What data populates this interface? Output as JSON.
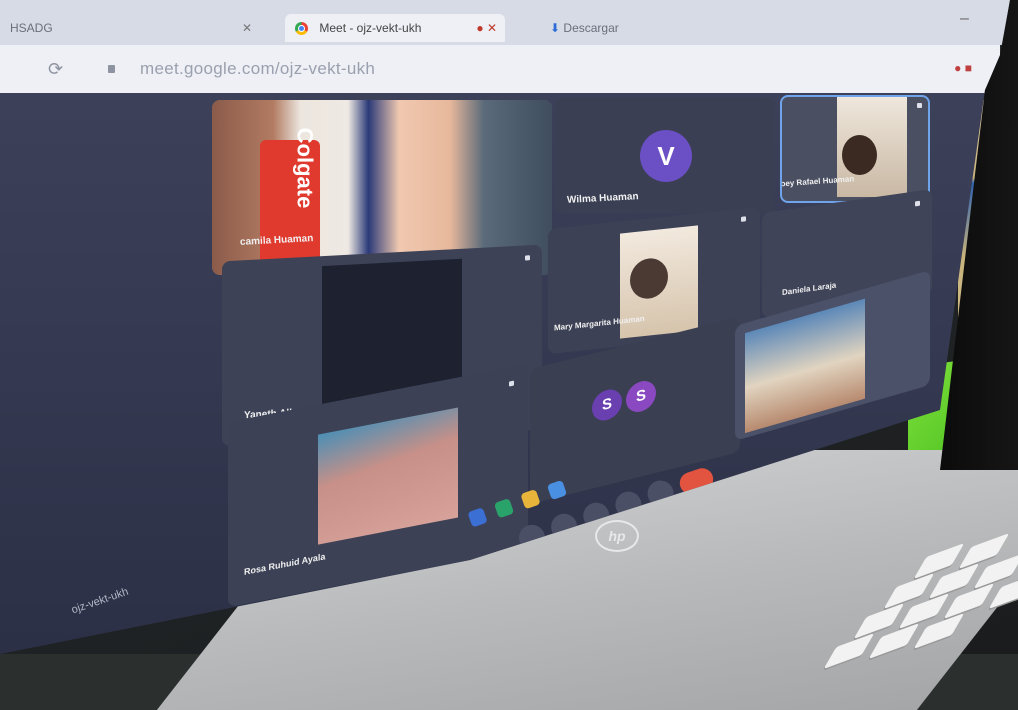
{
  "browser": {
    "tabs": [
      {
        "label": "HSADG",
        "active": false
      },
      {
        "label": "Meet - ojz-vekt-ukh",
        "active": true
      },
      {
        "label": "Descargar",
        "active": false
      }
    ],
    "url": "meet.google.com/ojz-vekt-ukh"
  },
  "meet": {
    "participants": [
      {
        "name": "camila Huaman",
        "type": "video"
      },
      {
        "name": "Wilma Huaman",
        "type": "avatar",
        "initial": "V",
        "color": "#6b4fc4"
      },
      {
        "name": "Joey Rafael Huaman",
        "type": "video"
      },
      {
        "name": "Yaneth Allasanca Mosqueira",
        "type": "video"
      },
      {
        "name": "Mary Margarita Huaman",
        "type": "video"
      },
      {
        "name": "Daniela Laraja",
        "type": "video"
      },
      {
        "name": "Rosa Ruhuid Ayala",
        "type": "video"
      },
      {
        "name": "S S",
        "type": "avatar-pair",
        "initials": [
          "S",
          "S"
        ]
      },
      {
        "name": "",
        "type": "video"
      }
    ],
    "meeting_code": "ojz-vekt-ukh"
  },
  "device": {
    "brand": "hp"
  }
}
